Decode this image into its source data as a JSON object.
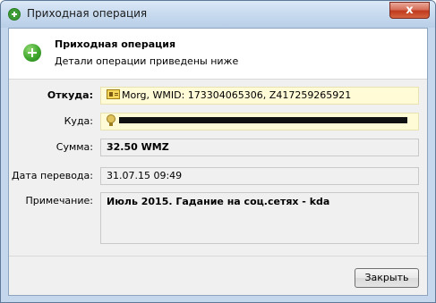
{
  "window": {
    "title": "Приходная операция",
    "close_glyph": "x"
  },
  "header": {
    "title": "Приходная операция",
    "subtitle": "Детали операции приведены ниже"
  },
  "fields": {
    "from_label": "Откуда:",
    "from_value": "Morg, WMID: 173304065306, Z417259265921",
    "to_label": "Куда:",
    "to_value": "",
    "amount_label": "Сумма:",
    "amount_value": "32.50 WMZ",
    "date_label": "Дата перевода:",
    "date_value": "31.07.15 09:49",
    "note_label": "Примечание:",
    "note_value": "Июль 2015. Гадание на соц.сетях  - kda"
  },
  "footer": {
    "close_label": "Закрыть"
  },
  "colors": {
    "accent_green": "#3fa62e",
    "highlight_yellow": "#fffbd6",
    "close_red": "#c0391e"
  },
  "icons": {
    "title": "green-plus-icon",
    "header": "green-plus-icon",
    "from": "id-card-icon",
    "to": "medal-icon"
  }
}
